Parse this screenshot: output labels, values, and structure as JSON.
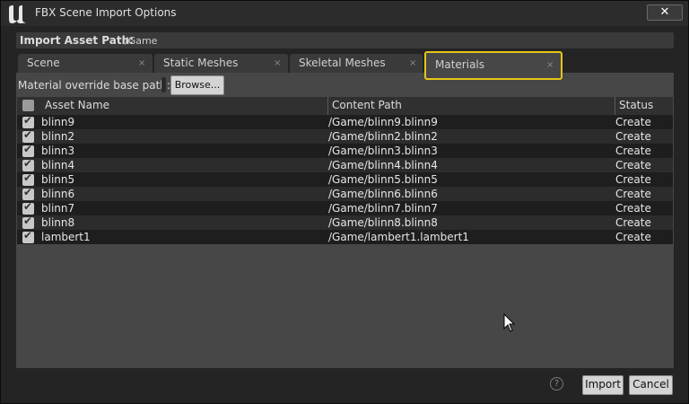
{
  "window": {
    "title": "FBX Scene Import Options",
    "close_symbol": "✕"
  },
  "import_path": {
    "label": "Import Asset Path:",
    "value": "/Game"
  },
  "tabs": [
    {
      "label": "Scene",
      "close": "×"
    },
    {
      "label": "Static Meshes",
      "close": "×"
    },
    {
      "label": "Skeletal Meshes",
      "close": "×"
    },
    {
      "label": "Materials",
      "close": "×"
    }
  ],
  "active_tab": "Materials",
  "override": {
    "label": "Material override base path:",
    "browse_label": "Browse..."
  },
  "table": {
    "columns": [
      "Asset Name",
      "Content Path",
      "Status"
    ],
    "rows": [
      {
        "checked": true,
        "name": "blinn9",
        "path": "/Game/blinn9.blinn9",
        "status": "Create"
      },
      {
        "checked": true,
        "name": "blinn2",
        "path": "/Game/blinn2.blinn2",
        "status": "Create"
      },
      {
        "checked": true,
        "name": "blinn3",
        "path": "/Game/blinn3.blinn3",
        "status": "Create"
      },
      {
        "checked": true,
        "name": "blinn4",
        "path": "/Game/blinn4.blinn4",
        "status": "Create"
      },
      {
        "checked": true,
        "name": "blinn5",
        "path": "/Game/blinn5.blinn5",
        "status": "Create"
      },
      {
        "checked": true,
        "name": "blinn6",
        "path": "/Game/blinn6.blinn6",
        "status": "Create"
      },
      {
        "checked": true,
        "name": "blinn7",
        "path": "/Game/blinn7.blinn7",
        "status": "Create"
      },
      {
        "checked": true,
        "name": "blinn8",
        "path": "/Game/blinn8.blinn8",
        "status": "Create"
      },
      {
        "checked": true,
        "name": "lambert1",
        "path": "/Game/lambert1.lambert1",
        "status": "Create"
      }
    ]
  },
  "footer": {
    "help_symbol": "?",
    "import_label": "Import",
    "cancel_label": "Cancel"
  },
  "colors": {
    "active_tab_border": "#e6c617",
    "panel_bg": "#474747",
    "window_bg": "#242424"
  }
}
